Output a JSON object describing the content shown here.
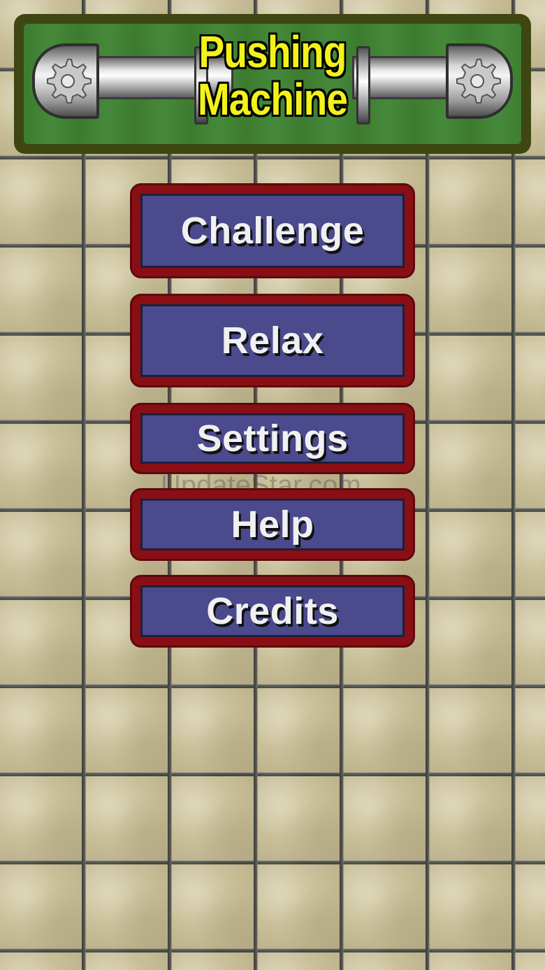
{
  "title": {
    "line1": "Pushing",
    "line2": "Machine"
  },
  "menu": {
    "challenge": "Challenge",
    "relax": "Relax",
    "settings": "Settings",
    "help": "Help",
    "credits": "Credits"
  },
  "watermark": "UpdateStar.com",
  "icons": {
    "left_gear": "gear-icon",
    "right_gear": "gear-icon"
  },
  "colors": {
    "title_text": "#f2f21a",
    "banner_green": "#3d7b2f",
    "button_red": "#8a0f14",
    "button_blue": "#4a4a8c"
  }
}
